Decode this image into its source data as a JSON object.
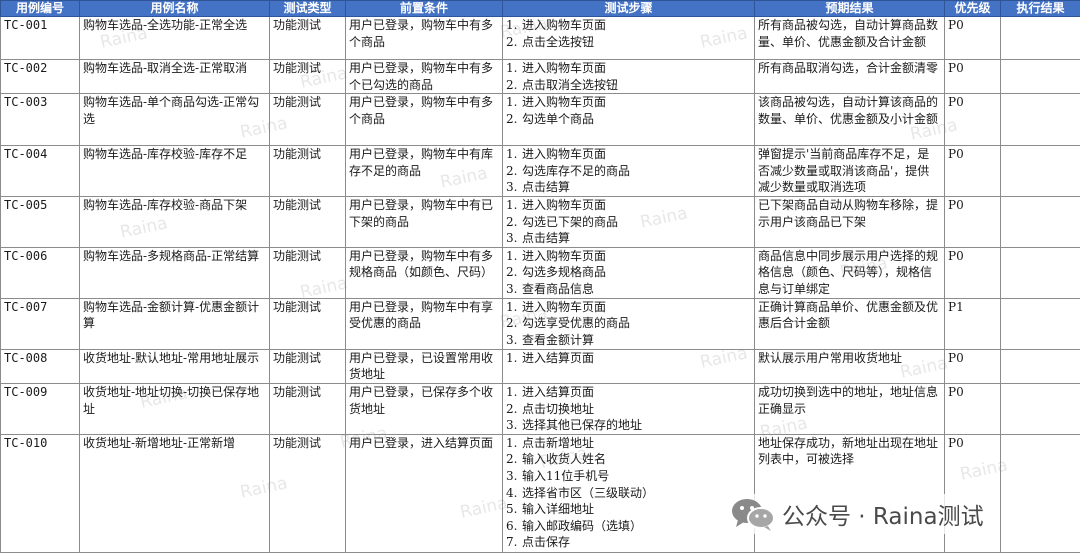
{
  "headers": [
    "用例编号",
    "用例名称",
    "测试类型",
    "前置条件",
    "测试步骤",
    "预期结果",
    "优先级",
    "执行结果"
  ],
  "rows": [
    {
      "id": "TC-001",
      "name": "购物车选品-全选功能-正常全选",
      "type": "功能测试",
      "pre": "用户已登录，购物车中有多个商品",
      "steps": [
        "进入购物车页面",
        "点击全选按钮"
      ],
      "expected": "所有商品被勾选，自动计算商品数量、单价、优惠金额及合计金额",
      "priority": "P0",
      "result": ""
    },
    {
      "id": "TC-002",
      "name": "购物车选品-取消全选-正常取消",
      "type": "功能测试",
      "pre": "用户已登录，购物车中有多个已勾选的商品",
      "steps": [
        "进入购物车页面",
        "点击取消全选按钮"
      ],
      "expected": "所有商品取消勾选，合计金额清零",
      "priority": "P0",
      "result": ""
    },
    {
      "id": "TC-003",
      "name": "购物车选品-单个商品勾选-正常勾选",
      "type": "功能测试",
      "pre": "用户已登录，购物车中有多个商品",
      "steps": [
        "进入购物车页面",
        "勾选单个商品"
      ],
      "expected": "该商品被勾选，自动计算该商品的数量、单价、优惠金额及小计金额",
      "priority": "P0",
      "result": ""
    },
    {
      "id": "TC-004",
      "name": "购物车选品-库存校验-库存不足",
      "type": "功能测试",
      "pre": "用户已登录，购物车中有库存不足的商品",
      "steps": [
        "进入购物车页面",
        "勾选库存不足的商品",
        "点击结算"
      ],
      "expected": "弹窗提示'当前商品库存不足，是否减少数量或取消该商品'，提供减少数量或取消选项",
      "priority": "P0",
      "result": ""
    },
    {
      "id": "TC-005",
      "name": "购物车选品-库存校验-商品下架",
      "type": "功能测试",
      "pre": "用户已登录，购物车中有已下架的商品",
      "steps": [
        "进入购物车页面",
        "勾选已下架的商品",
        "点击结算"
      ],
      "expected": "已下架商品自动从购物车移除，提示用户该商品已下架",
      "priority": "P0",
      "result": ""
    },
    {
      "id": "TC-006",
      "name": "购物车选品-多规格商品-正常结算",
      "type": "功能测试",
      "pre": "用户已登录，购物车中有多规格商品（如颜色、尺码）",
      "steps": [
        "进入购物车页面",
        "勾选多规格商品",
        "查看商品信息"
      ],
      "expected": "商品信息中同步展示用户选择的规格信息（颜色、尺码等），规格信息与订单绑定",
      "priority": "P0",
      "result": ""
    },
    {
      "id": "TC-007",
      "name": "购物车选品-金额计算-优惠金额计算",
      "type": "功能测试",
      "pre": "用户已登录，购物车中有享受优惠的商品",
      "steps": [
        "进入购物车页面",
        "勾选享受优惠的商品",
        "查看金额计算"
      ],
      "expected": "正确计算商品单价、优惠金额及优惠后合计金额",
      "priority": "P1",
      "result": ""
    },
    {
      "id": "TC-008",
      "name": "收货地址-默认地址-常用地址展示",
      "type": "功能测试",
      "pre": "用户已登录，已设置常用收货地址",
      "steps": [
        "进入结算页面"
      ],
      "expected": "默认展示用户常用收货地址",
      "priority": "P0",
      "result": ""
    },
    {
      "id": "TC-009",
      "name": "收货地址-地址切换-切换已保存地址",
      "type": "功能测试",
      "pre": "用户已登录，已保存多个收货地址",
      "steps": [
        "进入结算页面",
        "点击切换地址",
        "选择其他已保存的地址"
      ],
      "expected": "成功切换到选中的地址，地址信息正确显示",
      "priority": "P0",
      "result": ""
    },
    {
      "id": "TC-010",
      "name": "收货地址-新增地址-正常新增",
      "type": "功能测试",
      "pre": "用户已登录，进入结算页面",
      "steps": [
        "点击新增地址",
        "输入收货人姓名",
        "输入11位手机号",
        "选择省市区（三级联动）",
        "输入详细地址",
        "输入邮政编码（选填）",
        "点击保存"
      ],
      "expected": "地址保存成功，新地址出现在地址列表中，可被选择",
      "priority": "P0",
      "result": ""
    }
  ],
  "watermark": {
    "text": "Raina"
  },
  "brand": {
    "label": "公众号 · Raina测试",
    "icon": "wechat-icon"
  }
}
